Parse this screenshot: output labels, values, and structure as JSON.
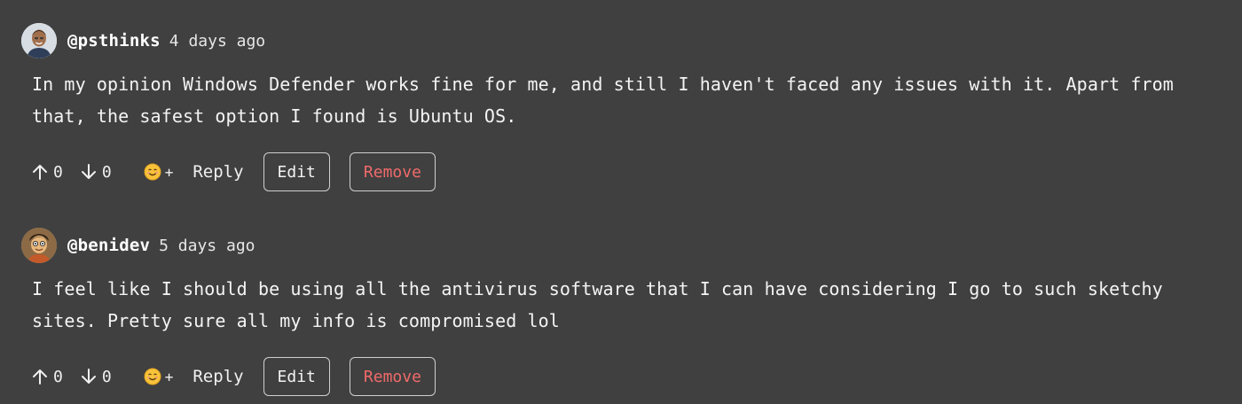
{
  "colors": {
    "background": "#404040",
    "text": "#f2f2f2",
    "remove_text": "#f06a6a",
    "button_border": "#cfcfcf"
  },
  "comments": [
    {
      "username": "@psthinks",
      "timestamp": "4 days ago",
      "text": "In my opinion Windows Defender works fine for me, and still I haven't faced any issues with it. Apart from that, the safest option I found is Ubuntu OS.",
      "upvotes": "0",
      "downvotes": "0",
      "react_plus": "+",
      "reply_label": "Reply",
      "edit_label": "Edit",
      "remove_label": "Remove",
      "avatar_icon": "avatar-psthinks"
    },
    {
      "username": "@benidev",
      "timestamp": "5 days ago",
      "text": "I feel like I should be using all the antivirus software that I can have considering I go to such sketchy sites. Pretty sure all my info is compromised lol",
      "upvotes": "0",
      "downvotes": "0",
      "react_plus": "+",
      "reply_label": "Reply",
      "edit_label": "Edit",
      "remove_label": "Remove",
      "avatar_icon": "avatar-benidev"
    }
  ]
}
